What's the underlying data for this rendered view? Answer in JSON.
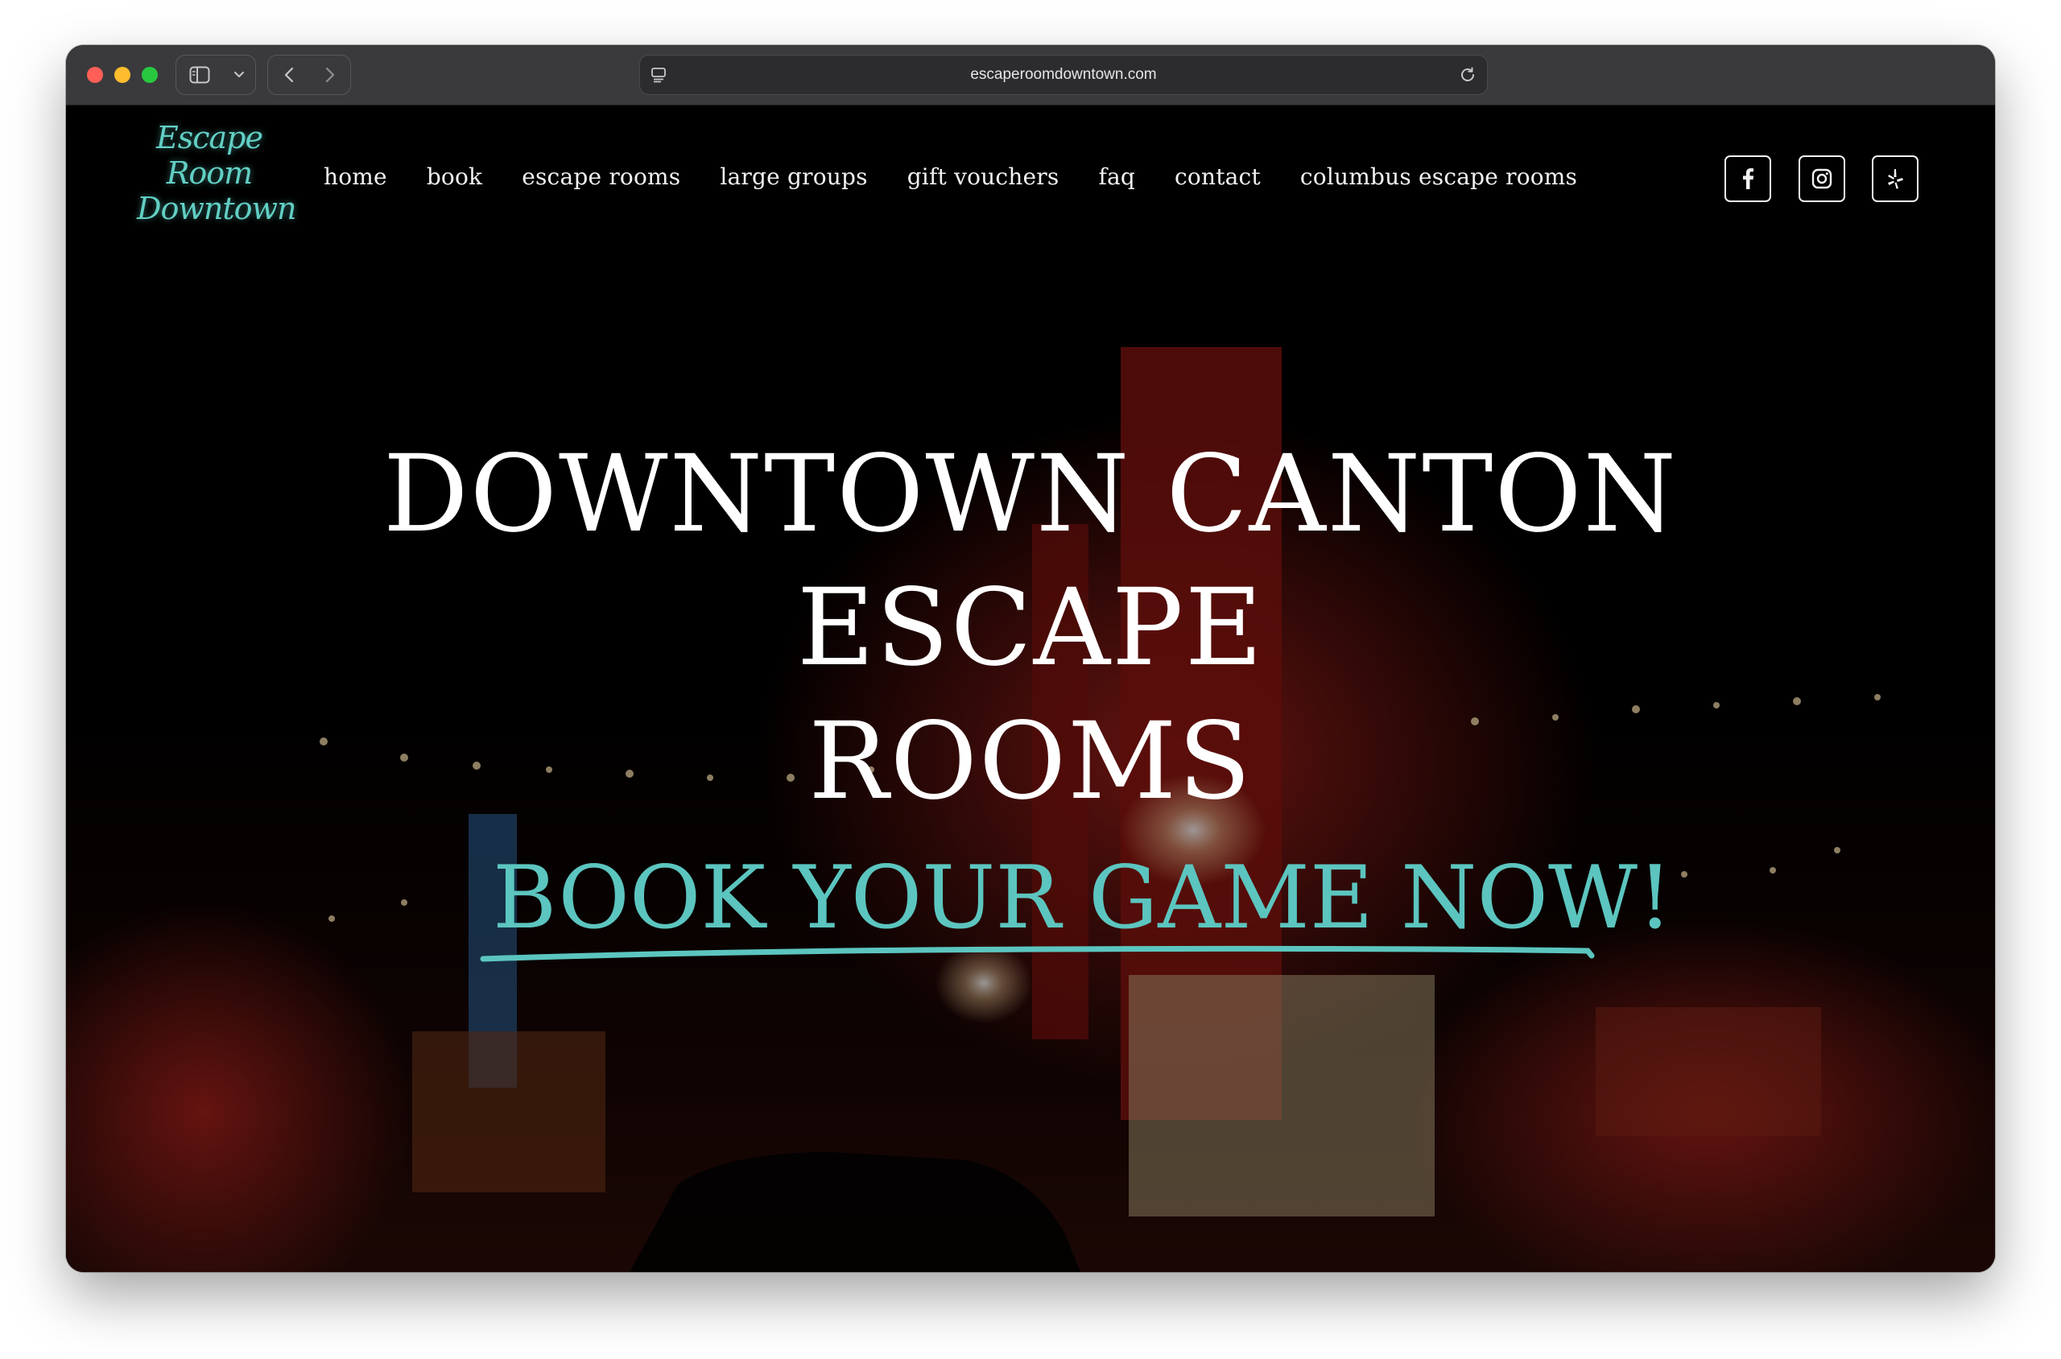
{
  "browser": {
    "url": "escaperoomdowntown.com"
  },
  "site": {
    "logo": [
      "Escape",
      "Room",
      "Downtown"
    ],
    "nav": [
      "home",
      "book",
      "escape rooms",
      "large groups",
      "gift vouchers",
      "faq",
      "contact",
      "columbus escape rooms"
    ],
    "social": [
      "facebook-icon",
      "instagram-icon",
      "yelp-icon"
    ]
  },
  "hero": {
    "headline_line1": "DOWNTOWN CANTON ESCAPE",
    "headline_line2": "ROOMS",
    "cta": "BOOK YOUR GAME NOW!"
  },
  "colors": {
    "accent": "#5cc5bf",
    "titlebar": "#3a3a3c",
    "background": "#000000"
  }
}
